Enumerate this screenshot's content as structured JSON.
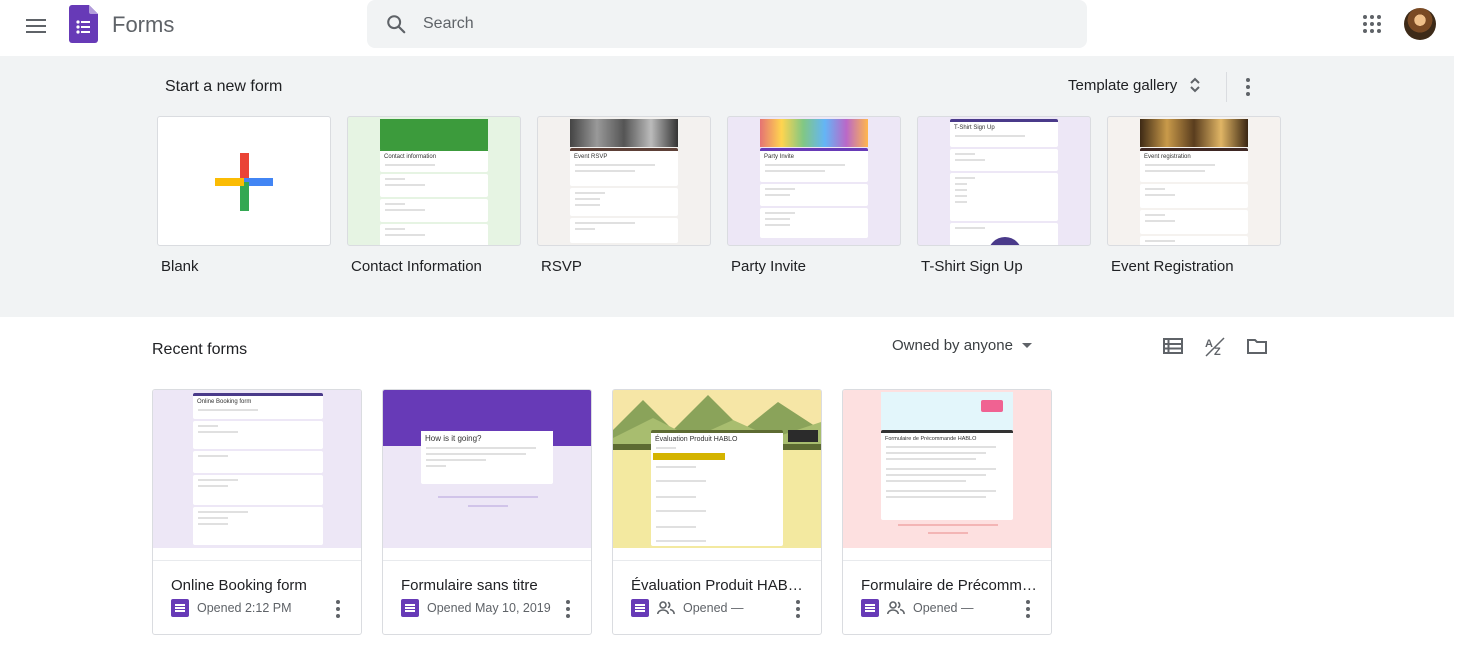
{
  "header": {
    "app_name": "Forms",
    "search_placeholder": "Search"
  },
  "new_form": {
    "title": "Start a new form",
    "template_gallery_label": "Template gallery",
    "templates": [
      {
        "label": "Blank"
      },
      {
        "label": "Contact Information",
        "preview_title": "Contact information"
      },
      {
        "label": "RSVP",
        "preview_title": "Event RSVP"
      },
      {
        "label": "Party Invite",
        "preview_title": "Party Invite"
      },
      {
        "label": "T-Shirt Sign Up",
        "preview_title": "T-Shirt Sign Up"
      },
      {
        "label": "Event Registration",
        "preview_title": "Event registration"
      }
    ]
  },
  "recent": {
    "title": "Recent forms",
    "owner_filter": "Owned by anyone",
    "docs": [
      {
        "name": "Online Booking form",
        "meta": "Opened 2:12 PM",
        "shared": false,
        "preview_title": "Online Booking form"
      },
      {
        "name": "Formulaire sans titre",
        "meta": "Opened May 10, 2019",
        "shared": false,
        "preview_title": "How is it going?"
      },
      {
        "name": "Évaluation Produit HABLO",
        "meta": "Opened —",
        "shared": true,
        "preview_title": "Évaluation Produit HABLO"
      },
      {
        "name": "Formulaire de Précomma...",
        "meta": "Opened —",
        "shared": true,
        "preview_title": "Formulaire de Précommande HABLO"
      }
    ]
  },
  "colors": {
    "forms_purple": "#673ab7",
    "header_bg": "#ffffff",
    "section_bg": "#f1f3f4",
    "plus_red": "#ea4335",
    "plus_blue": "#4285f4",
    "plus_yellow": "#fbbc04",
    "plus_green": "#34a853"
  }
}
